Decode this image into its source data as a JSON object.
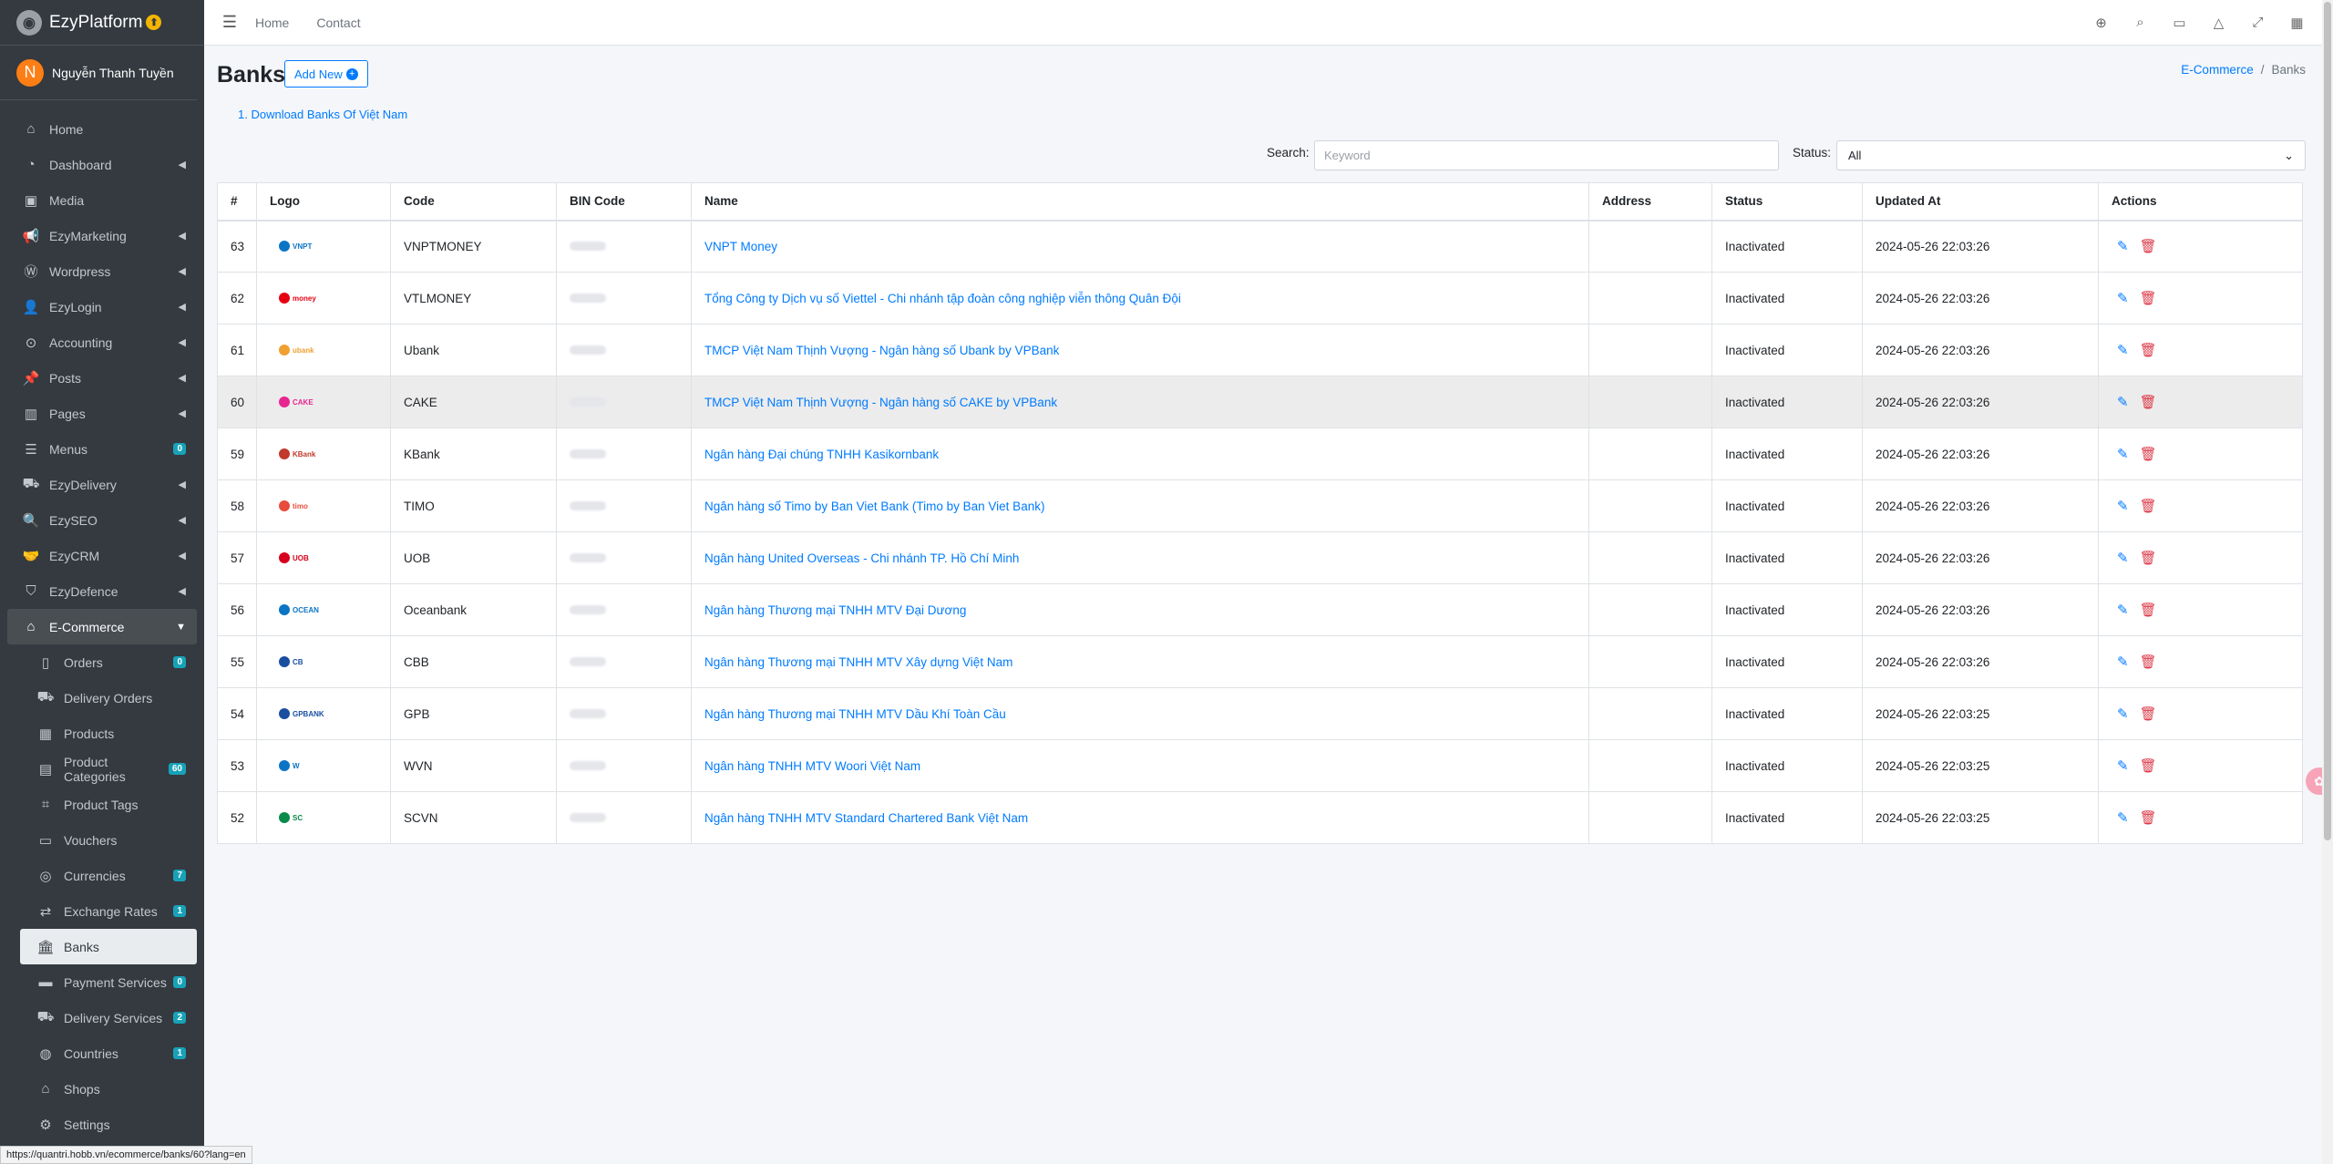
{
  "brand": {
    "name": "EzyPlatform",
    "badge": "⬆"
  },
  "user": {
    "initial": "N",
    "name": "Nguyễn Thanh Tuyền"
  },
  "sidebar": {
    "items": [
      {
        "name": "sidebar-item-home",
        "icon": "home-icon",
        "glyph": "⌂",
        "label": "Home",
        "chevron": false,
        "badge": ""
      },
      {
        "name": "sidebar-item-dashboard",
        "icon": "dashboard-icon",
        "glyph": "◔",
        "label": "Dashboard",
        "chevron": true,
        "badge": ""
      },
      {
        "name": "sidebar-item-media",
        "icon": "image-icon",
        "glyph": "▣",
        "label": "Media",
        "chevron": false,
        "badge": ""
      },
      {
        "name": "sidebar-item-ezymarketing",
        "icon": "megaphone-icon",
        "glyph": "📢",
        "label": "EzyMarketing",
        "chevron": true,
        "badge": ""
      },
      {
        "name": "sidebar-item-wordpress",
        "icon": "wordpress-icon",
        "glyph": "Ⓦ",
        "label": "Wordpress",
        "chevron": true,
        "badge": ""
      },
      {
        "name": "sidebar-item-ezylogin",
        "icon": "user-lock-icon",
        "glyph": "👤",
        "label": "EzyLogin",
        "chevron": true,
        "badge": ""
      },
      {
        "name": "sidebar-item-accounting",
        "icon": "coins-icon",
        "glyph": "⊙",
        "label": "Accounting",
        "chevron": true,
        "badge": ""
      },
      {
        "name": "sidebar-item-posts",
        "icon": "thumbtack-icon",
        "glyph": "📌",
        "label": "Posts",
        "chevron": true,
        "badge": ""
      },
      {
        "name": "sidebar-item-pages",
        "icon": "columns-icon",
        "glyph": "▥",
        "label": "Pages",
        "chevron": true,
        "badge": ""
      },
      {
        "name": "sidebar-item-menus",
        "icon": "bars-icon",
        "glyph": "☰",
        "label": "Menus",
        "chevron": false,
        "badge": "0"
      },
      {
        "name": "sidebar-item-ezydelivery",
        "icon": "truck-icon",
        "glyph": "⛟",
        "label": "EzyDelivery",
        "chevron": true,
        "badge": ""
      },
      {
        "name": "sidebar-item-ezyseo",
        "icon": "search-plus-icon",
        "glyph": "🔍",
        "label": "EzySEO",
        "chevron": true,
        "badge": ""
      },
      {
        "name": "sidebar-item-ezycrm",
        "icon": "handshake-icon",
        "glyph": "🤝",
        "label": "EzyCRM",
        "chevron": true,
        "badge": ""
      },
      {
        "name": "sidebar-item-ezydefence",
        "icon": "shield-icon",
        "glyph": "⛉",
        "label": "EzyDefence",
        "chevron": true,
        "badge": ""
      },
      {
        "name": "sidebar-item-ecommerce",
        "icon": "store-icon",
        "glyph": "⌂",
        "label": "E-Commerce",
        "chevron": true,
        "open": true,
        "badge": ""
      },
      {
        "name": "sidebar-item-orders",
        "icon": "file-icon",
        "glyph": "▯",
        "label": "Orders",
        "sub": true,
        "badge": "0"
      },
      {
        "name": "sidebar-item-delivery-orders",
        "icon": "dolly-icon",
        "glyph": "⛟",
        "label": "Delivery Orders",
        "sub": true,
        "badge": ""
      },
      {
        "name": "sidebar-item-products",
        "icon": "box-icon",
        "glyph": "▦",
        "label": "Products",
        "sub": true,
        "badge": ""
      },
      {
        "name": "sidebar-item-product-categories",
        "icon": "file-alt-icon",
        "glyph": "▤",
        "label": "Product Categories",
        "sub": true,
        "badge": "60"
      },
      {
        "name": "sidebar-item-product-tags",
        "icon": "tags-icon",
        "glyph": "⌗",
        "label": "Product Tags",
        "sub": true,
        "badge": ""
      },
      {
        "name": "sidebar-item-vouchers",
        "icon": "ticket-icon",
        "glyph": "▭",
        "label": "Vouchers",
        "sub": true,
        "badge": ""
      },
      {
        "name": "sidebar-item-currencies",
        "icon": "coin-icon",
        "glyph": "◎",
        "label": "Currencies",
        "sub": true,
        "badge": "7"
      },
      {
        "name": "sidebar-item-exchange-rates",
        "icon": "exchange-icon",
        "glyph": "⇄",
        "label": "Exchange Rates",
        "sub": true,
        "badge": "1"
      },
      {
        "name": "sidebar-item-banks",
        "icon": "bank-icon",
        "glyph": "🏛",
        "label": "Banks",
        "sub": true,
        "active": true,
        "badge": ""
      },
      {
        "name": "sidebar-item-payment-services",
        "icon": "credit-card-icon",
        "glyph": "▬",
        "label": "Payment Services",
        "sub": true,
        "badge": "0"
      },
      {
        "name": "sidebar-item-delivery-services",
        "icon": "truck-icon",
        "glyph": "⛟",
        "label": "Delivery Services",
        "sub": true,
        "badge": "2"
      },
      {
        "name": "sidebar-item-countries",
        "icon": "globe-icon",
        "glyph": "◍",
        "label": "Countries",
        "sub": true,
        "badge": "1"
      },
      {
        "name": "sidebar-item-shops",
        "icon": "store-icon",
        "glyph": "⌂",
        "label": "Shops",
        "sub": true,
        "badge": ""
      },
      {
        "name": "sidebar-item-settings",
        "icon": "gear-icon",
        "glyph": "⚙",
        "label": "Settings",
        "sub": true,
        "badge": ""
      }
    ]
  },
  "topbar": {
    "links": [
      "Home",
      "Contact"
    ],
    "icons": [
      "globe-icon",
      "search-icon",
      "comments-icon",
      "bell-icon",
      "expand-icon",
      "grid-icon"
    ]
  },
  "page": {
    "title": "Banks",
    "add_new": "Add New",
    "breadcrumb": {
      "parent": "E-Commerce",
      "sep": "/",
      "current": "Banks"
    },
    "download_link": "1. Download Banks Of Việt Nam",
    "search": {
      "label": "Search:",
      "placeholder": "Keyword"
    },
    "status": {
      "label": "Status:",
      "value": "All"
    }
  },
  "table": {
    "columns": [
      "#",
      "Logo",
      "Code",
      "BIN Code",
      "Name",
      "Address",
      "Status",
      "Updated At",
      "Actions"
    ],
    "rows": [
      {
        "id": "63",
        "logo": "VNPT",
        "logo_color": "#0b74c4",
        "code": "VNPTMONEY",
        "name": "VNPT Money",
        "status": "Inactivated",
        "updated": "2024-05-26 22:03:26"
      },
      {
        "id": "62",
        "logo": "money",
        "logo_color": "#e60012",
        "code": "VTLMONEY",
        "name": "Tổng Công ty Dịch vụ số Viettel - Chi nhánh tập đoàn công nghiệp viễn thông Quân Đội",
        "status": "Inactivated",
        "updated": "2024-05-26 22:03:26"
      },
      {
        "id": "61",
        "logo": "ubank",
        "logo_color": "#f0a030",
        "code": "Ubank",
        "name": "TMCP Việt Nam Thịnh Vượng - Ngân hàng số Ubank by VPBank",
        "status": "Inactivated",
        "updated": "2024-05-26 22:03:26"
      },
      {
        "id": "60",
        "logo": "CAKE",
        "logo_color": "#e8268f",
        "code": "CAKE",
        "name": "TMCP Việt Nam Thịnh Vượng - Ngân hàng số CAKE by VPBank",
        "status": "Inactivated",
        "updated": "2024-05-26 22:03:26",
        "hover": true
      },
      {
        "id": "59",
        "logo": "KBank",
        "logo_color": "#c0392b",
        "code": "KBank",
        "name": "Ngân hàng Đại chúng TNHH Kasikornbank",
        "status": "Inactivated",
        "updated": "2024-05-26 22:03:26"
      },
      {
        "id": "58",
        "logo": "timo",
        "logo_color": "#e74c3c",
        "code": "TIMO",
        "name": "Ngân hàng số Timo by Ban Viet Bank (Timo by Ban Viet Bank)",
        "status": "Inactivated",
        "updated": "2024-05-26 22:03:26"
      },
      {
        "id": "57",
        "logo": "UOB",
        "logo_color": "#d6001c",
        "code": "UOB",
        "name": "Ngân hàng United Overseas - Chi nhánh TP. Hồ Chí Minh",
        "status": "Inactivated",
        "updated": "2024-05-26 22:03:26"
      },
      {
        "id": "56",
        "logo": "OCEAN",
        "logo_color": "#0b74c4",
        "code": "Oceanbank",
        "name": "Ngân hàng Thương mại TNHH MTV Đại Dương",
        "status": "Inactivated",
        "updated": "2024-05-26 22:03:26"
      },
      {
        "id": "55",
        "logo": "CB",
        "logo_color": "#1a4fa0",
        "code": "CBB",
        "name": "Ngân hàng Thương mại TNHH MTV Xây dựng Việt Nam",
        "status": "Inactivated",
        "updated": "2024-05-26 22:03:26"
      },
      {
        "id": "54",
        "logo": "GPBANK",
        "logo_color": "#1a4fa0",
        "code": "GPB",
        "name": "Ngân hàng Thương mại TNHH MTV Dầu Khí Toàn Cầu",
        "status": "Inactivated",
        "updated": "2024-05-26 22:03:25"
      },
      {
        "id": "53",
        "logo": "W",
        "logo_color": "#0b74c4",
        "code": "WVN",
        "name": "Ngân hàng TNHH MTV Woori Việt Nam",
        "status": "Inactivated",
        "updated": "2024-05-26 22:03:25"
      },
      {
        "id": "52",
        "logo": "SC",
        "logo_color": "#0a8a4a",
        "code": "SCVN",
        "name": "Ngân hàng TNHH MTV Standard Chartered Bank Việt Nam",
        "status": "Inactivated",
        "updated": "2024-05-26 22:03:25"
      }
    ]
  },
  "statusbar": {
    "url": "https://quantri.hobb.vn/ecommerce/banks/60?lang=en"
  },
  "colors": {
    "accent": "#007bff",
    "sidebar": "#343a40",
    "danger": "#dc3545",
    "badge": "#17a2b8"
  }
}
